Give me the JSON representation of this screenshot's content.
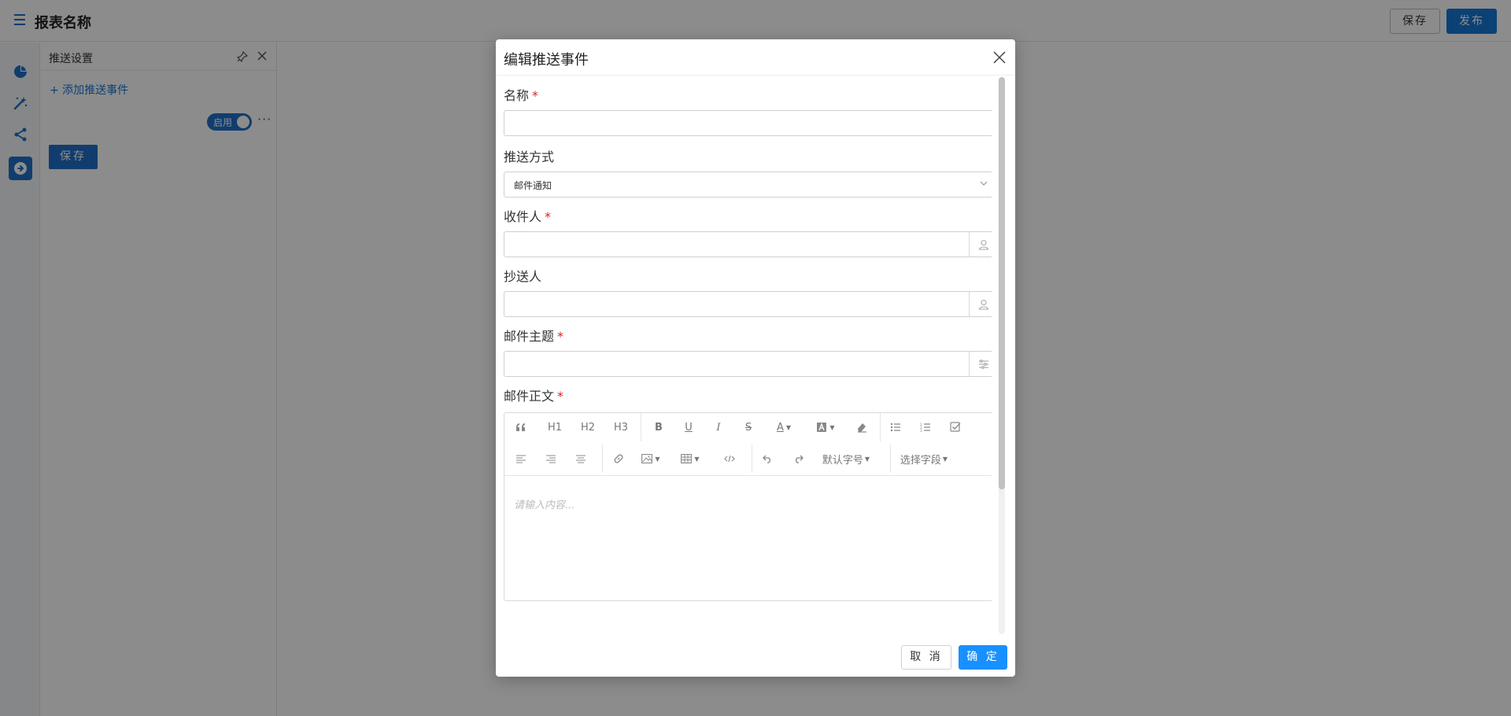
{
  "header": {
    "title": "报表名称",
    "save_label": "保存",
    "publish_label": "发布"
  },
  "rail": {
    "items": [
      {
        "icon": "pie-chart-icon"
      },
      {
        "icon": "magic-wand-icon"
      },
      {
        "icon": "share-icon"
      },
      {
        "icon": "push-message-icon",
        "active": true
      }
    ]
  },
  "panel": {
    "title": "推送设置",
    "add_event_label": "+ 添加推送事件",
    "toggle_label": "启用",
    "more_label": "···",
    "save_label": "保存"
  },
  "modal": {
    "title": "编辑推送事件",
    "fields": {
      "name": {
        "label": "名称",
        "required": "*",
        "value": ""
      },
      "method": {
        "label": "推送方式",
        "value": "邮件通知"
      },
      "recipients": {
        "label": "收件人",
        "required": "*",
        "value": ""
      },
      "cc": {
        "label": "抄送人",
        "value": ""
      },
      "subject": {
        "label": "邮件主题",
        "required": "*",
        "value": ""
      },
      "body": {
        "label": "邮件正文",
        "required": "*",
        "placeholder": "请输入内容..."
      }
    },
    "toolbar": {
      "h1": "H1",
      "h2": "H2",
      "h3": "H3",
      "bold": "B",
      "underline": "U",
      "italic": "I",
      "strike": "S",
      "font_color": "A",
      "font_size": "默认字号",
      "select_field": "选择字段"
    },
    "cancel_label": "取 消",
    "ok_label": "确 定"
  },
  "colors": {
    "accent": "#1677d6",
    "primary_button": "#1890ff",
    "required": "#e02020",
    "overlay": "rgba(0,0,0,0.45)"
  }
}
